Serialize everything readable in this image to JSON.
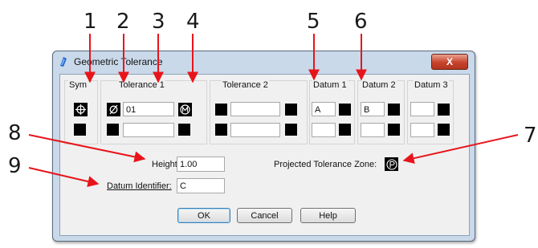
{
  "callouts": [
    "1",
    "2",
    "3",
    "4",
    "5",
    "6",
    "7",
    "8",
    "9"
  ],
  "dialog": {
    "title": "Geometric Tolerance",
    "close_label": "X",
    "groups": {
      "sym": "Sym",
      "tolerance1": "Tolerance 1",
      "tolerance2": "Tolerance 2",
      "datum1": "Datum 1",
      "datum2": "Datum 2",
      "datum3": "Datum 3"
    },
    "row1": {
      "tolerance1_value": "01",
      "datum1_value": "A",
      "datum2_value": "B"
    },
    "height_label": "Height:",
    "height_value": "1.00",
    "projected_label": "Projected Tolerance Zone:",
    "datum_identifier_label": "Datum Identifier:",
    "datum_identifier_value": "C",
    "buttons": {
      "ok": "OK",
      "cancel": "Cancel",
      "help": "Help"
    }
  },
  "icons": {
    "app": "geometric-tolerance-app-icon",
    "symbol": "position-symbol-icon",
    "diameter": "diameter-icon",
    "material": "mmc-icon",
    "projected": "projected-zone-icon"
  }
}
